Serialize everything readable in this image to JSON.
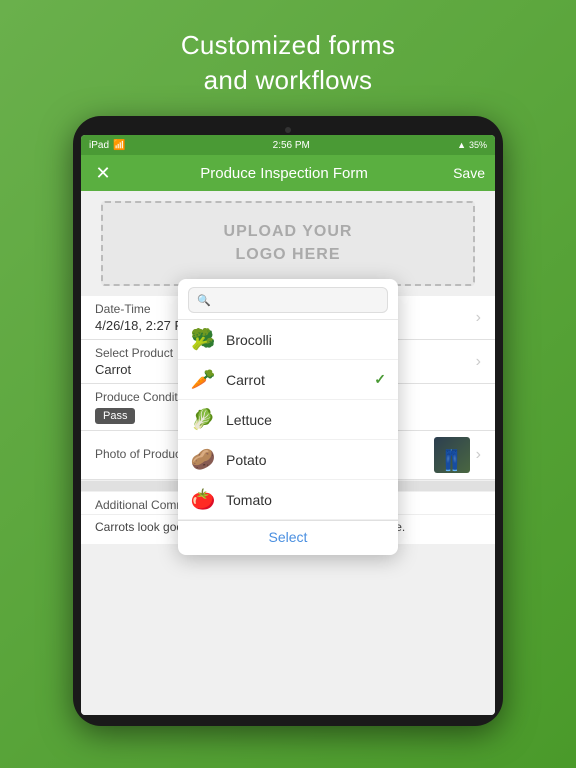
{
  "headline": {
    "line1": "Customized forms",
    "line2": "and workflows"
  },
  "statusBar": {
    "device": "iPad",
    "wifi": "WiFi",
    "time": "2:56 PM",
    "signal": "▲",
    "battery": "35%"
  },
  "navBar": {
    "title": "Produce Inspection Form",
    "saveLabel": "Save",
    "closeIcon": "✕"
  },
  "logoArea": {
    "text": "UPLOAD YOUR\nLOGO HERE"
  },
  "formFields": [
    {
      "label": "Date-Time",
      "value": "4/26/18, 2:27 PM",
      "hasArrow": true
    },
    {
      "label": "Select Product",
      "value": "Carrot",
      "hasArrow": true
    }
  ],
  "produceCondition": {
    "label": "Produce Condition",
    "badge": "Pass"
  },
  "photoField": {
    "label": "Photo of Produce (Mark"
  },
  "dropdown": {
    "searchPlaceholder": "",
    "items": [
      {
        "emoji": "🥦",
        "label": "Brocolli",
        "checked": false
      },
      {
        "emoji": "🥕",
        "label": "Carrot",
        "checked": true
      },
      {
        "emoji": "🥬",
        "label": "Lettuce",
        "checked": false
      },
      {
        "emoji": "🥔",
        "label": "Potato",
        "checked": false
      },
      {
        "emoji": "🍅",
        "label": "Tomato",
        "checked": false
      }
    ],
    "selectButton": "Select"
  },
  "additionalComments": {
    "label": "Additional Comments",
    "text": "Carrots look good but need to be cleaned well before sale."
  },
  "colors": {
    "green": "#5aaf40",
    "checkBlue": "#4a8fe0"
  }
}
